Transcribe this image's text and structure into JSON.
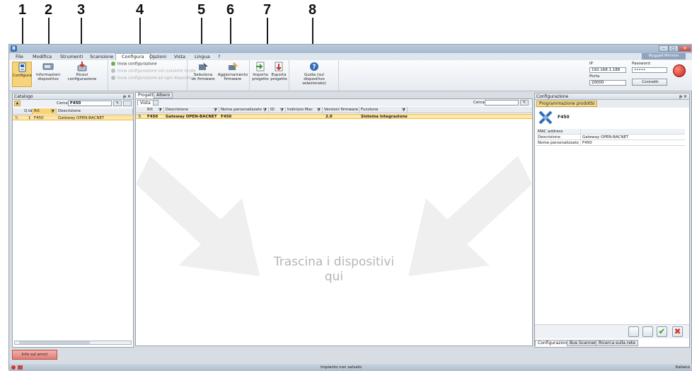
{
  "callouts": [
    "1",
    "2",
    "3",
    "4",
    "5",
    "6",
    "7",
    "8"
  ],
  "window": {
    "title": "",
    "user": "Wyggwll Mlmmm",
    "controls": [
      "–",
      "□",
      "✕"
    ]
  },
  "menu": {
    "items": [
      "File",
      "Modifica",
      "Strumenti",
      "Scansione",
      "Configura",
      "Opzioni",
      "Vista",
      "Lingua",
      "?"
    ],
    "active": "Configura"
  },
  "ribbon": {
    "configura": "Configura",
    "info": [
      "Informazioni",
      "dispositivo"
    ],
    "ricevi": [
      "Ricevi",
      "configurazione"
    ],
    "invia": [
      {
        "label": "Invia configurazione",
        "enabled": true
      },
      {
        "label": "Invia configurazione con pulsante locale",
        "enabled": false
      },
      {
        "label": "Invia configurazione ad ogni dispositivo",
        "enabled": false
      }
    ],
    "seleziona": [
      "Seleziona",
      "un firmware"
    ],
    "aggiornamento": [
      "Aggiornamento",
      "firmware"
    ],
    "importa": [
      "Importa",
      "progetto"
    ],
    "esporta": [
      "Esporta",
      "progetto"
    ],
    "guida": [
      "Guida (sul",
      "dispositivo selezionato)"
    ],
    "ip_label": "IP",
    "ip_value": "192.168.1.188",
    "porta_label": "Porta",
    "porta_value": "20000",
    "password_label": "Password",
    "password_value": "•••••",
    "connetti": "Connetti"
  },
  "catalogo": {
    "title": "Catalogo",
    "pin": "ᵽ ✕",
    "cerca_label": "Cerca",
    "cerca_value": "F450",
    "columns": [
      "Q.tà",
      "Rif.",
      "Descrizione"
    ],
    "rows": [
      {
        "qty": "1",
        "ref": "F450",
        "desc": "Gateway OPEN-BACNET"
      }
    ],
    "error_button": "Info sul errori"
  },
  "progetto": {
    "tabs": [
      "Progetto",
      "Albero"
    ],
    "vista": "Vista",
    "cerca_label": "Cerca",
    "columns": [
      "Rif.",
      "Descrizione",
      "Nome personalizzato",
      "ID",
      "Indirizzo Mac",
      "Versioni firmware",
      "Funzione"
    ],
    "rows": [
      {
        "ref": "F450",
        "desc": "Gateway OPEN-BACNET",
        "name": "F450",
        "id": "",
        "mac": "",
        "fw": "2.0",
        "func": "Sistema integrazione"
      }
    ],
    "drop_text": [
      "Trascina i dispositivi",
      "qui"
    ]
  },
  "configurazione": {
    "title": "Configurazione",
    "pin": "ᵽ ✕",
    "tab": "Programmazione prodotto",
    "device": "F450",
    "fields": [
      {
        "key": "MAC address",
        "value": ""
      },
      {
        "key": "Descrizione",
        "value": "Gateway OPEN-BACNET"
      },
      {
        "key": "Nome personalizzato",
        "value": "F450"
      }
    ],
    "bottom_tabs": [
      "Configurazione",
      "Bus Scanner",
      "Ricerca sulla rete"
    ]
  },
  "status": {
    "center": "Impianto non salvato",
    "right": "Italiano"
  },
  "colors": {
    "accent": "#f7d37a",
    "selected_row": "#ffe7a8",
    "ribbon_bg": "#eef2f6"
  }
}
